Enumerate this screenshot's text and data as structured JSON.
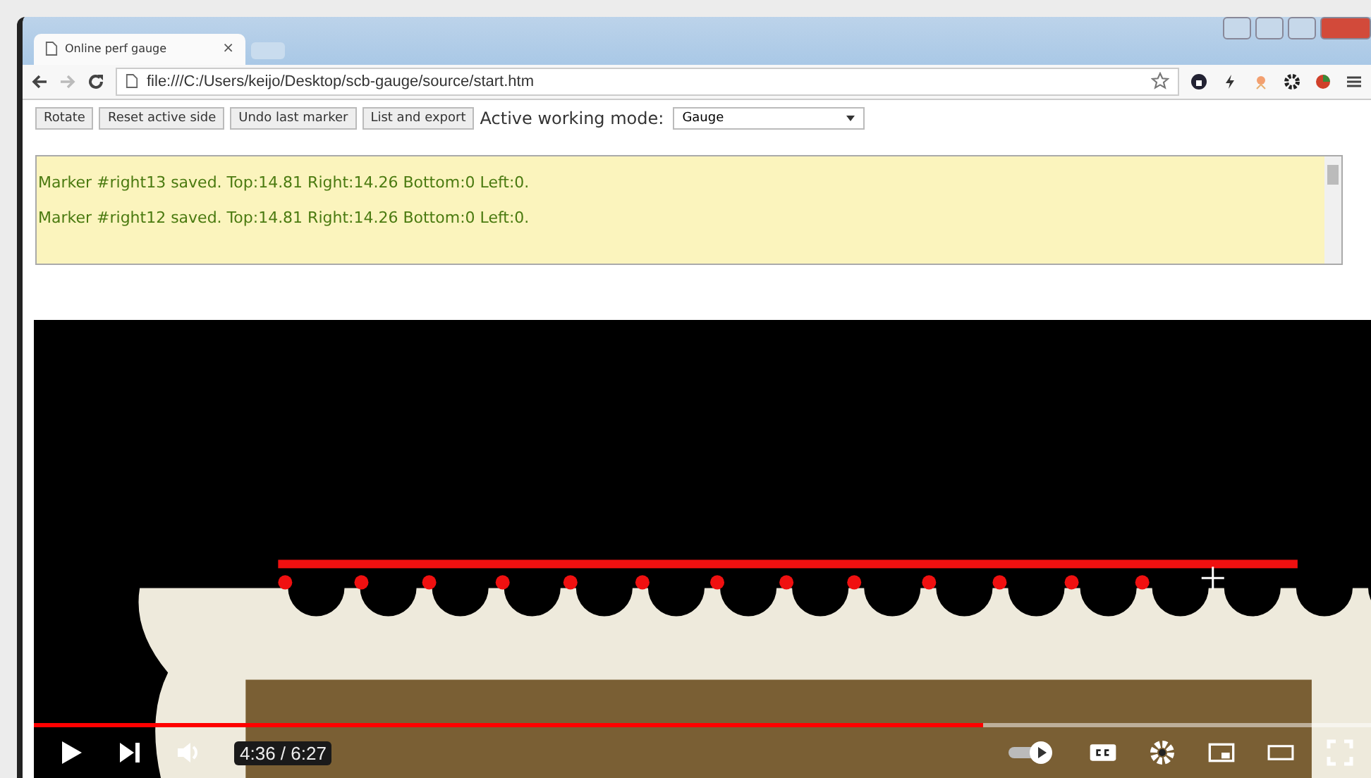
{
  "browser": {
    "tab_title": "Online perf gauge",
    "tab_close": "×",
    "url": "file:///C:/Users/keijo/Desktop/scb-gauge/source/start.htm"
  },
  "toolbar": {
    "buttons": [
      "Rotate",
      "Reset active side",
      "Undo last marker",
      "List and export"
    ],
    "mode_label": "Active working mode:",
    "mode_value": "Gauge"
  },
  "log": [
    "Marker #right13 saved. Top:14.81 Right:14.26 Bottom:0 Left:0.",
    "Marker #right12 saved. Top:14.81 Right:14.26 Bottom:0 Left:0."
  ],
  "player": {
    "progress": {
      "level": 0.71
    },
    "time": "4:36 / 6:27"
  }
}
